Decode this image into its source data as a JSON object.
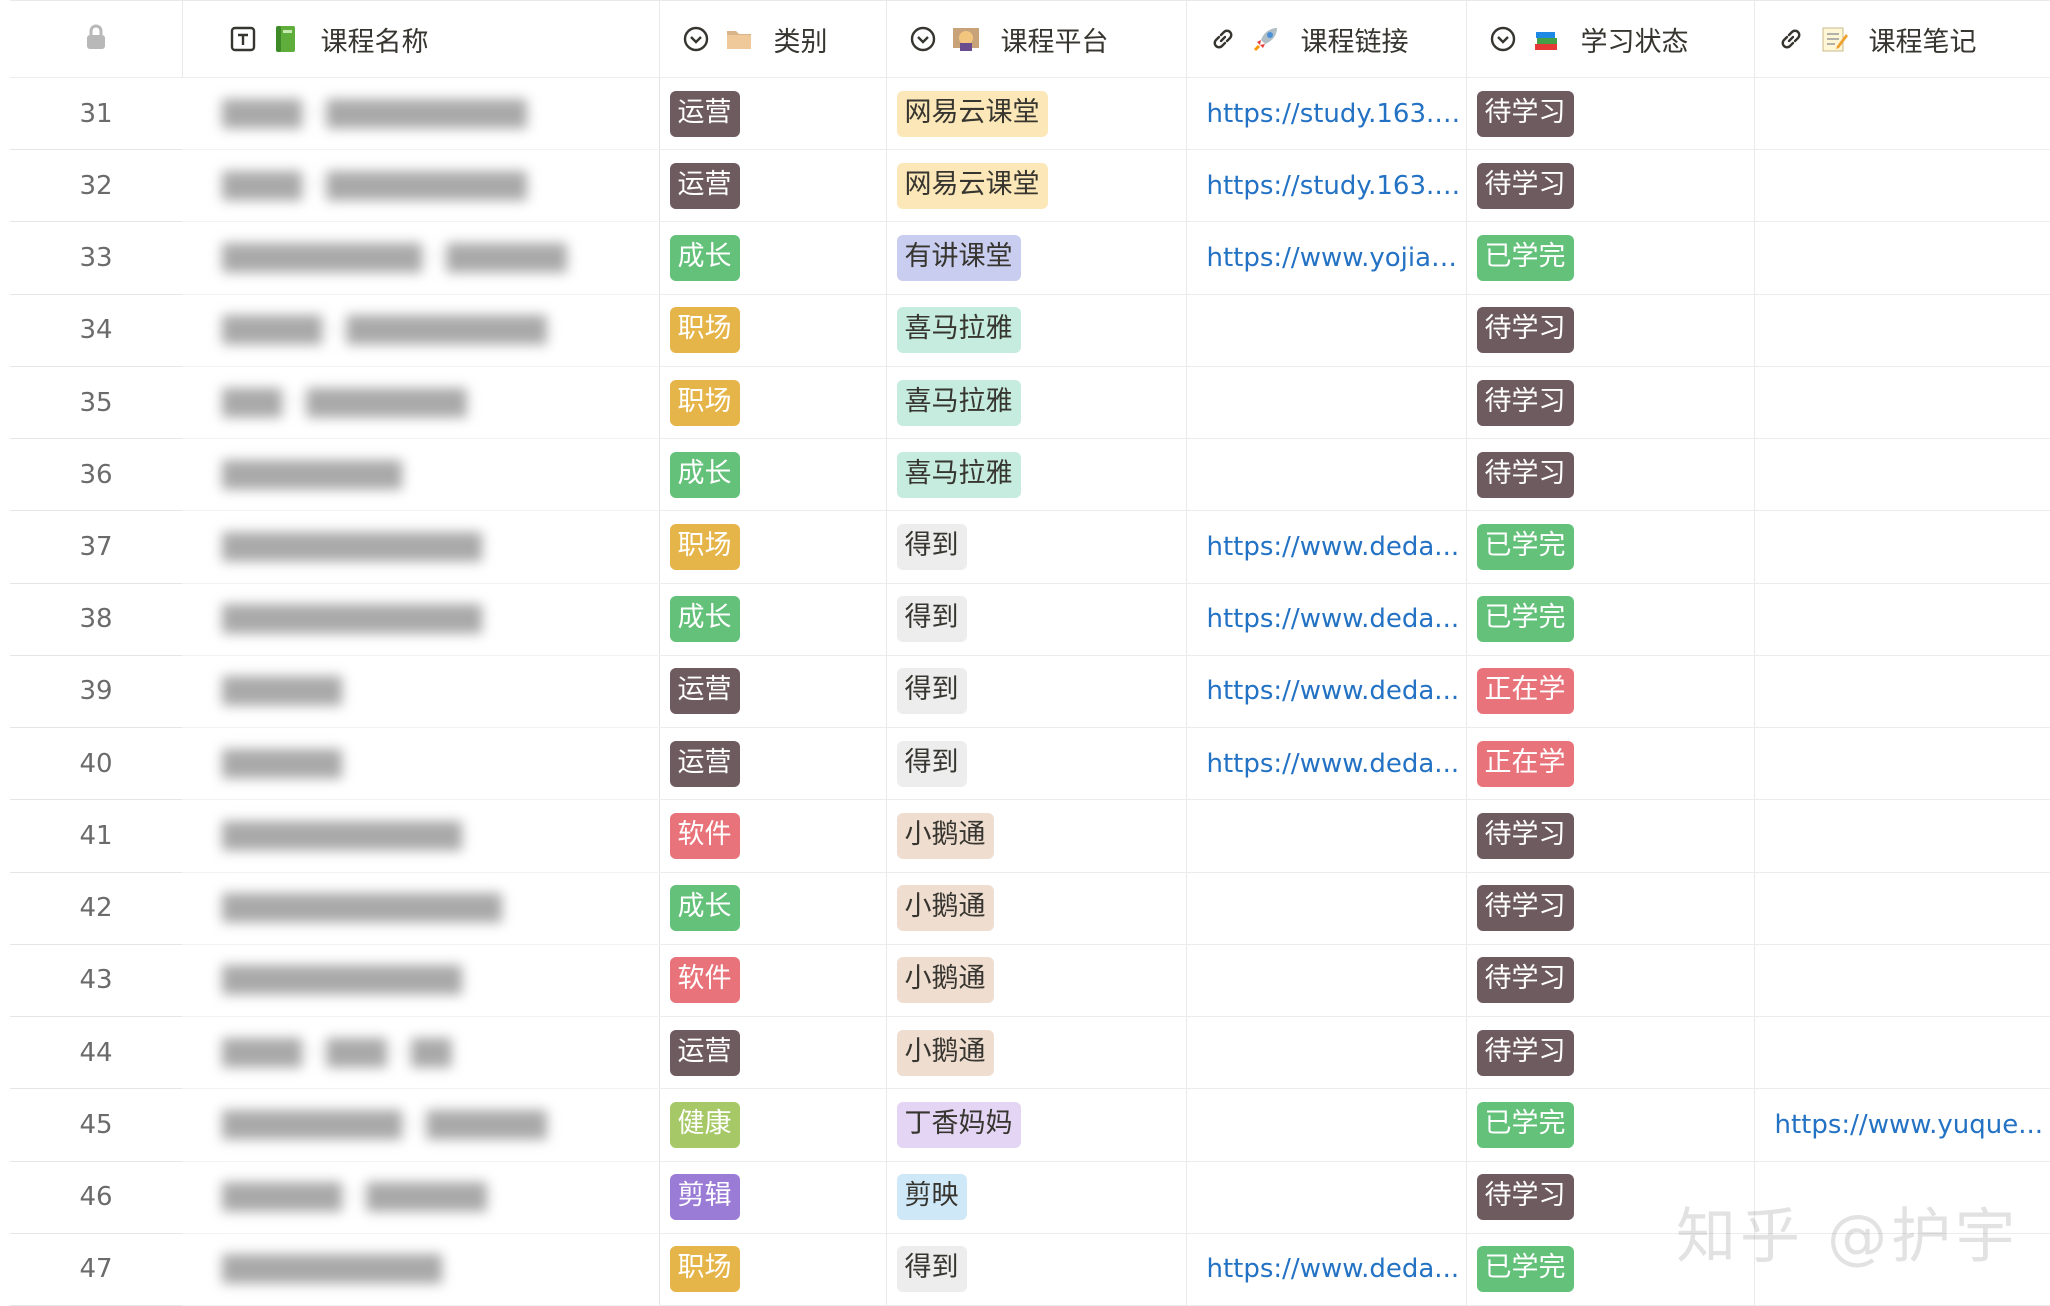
{
  "header": {
    "columns": [
      {
        "name": "col-lock",
        "type": "lock"
      },
      {
        "name": "col-course-name",
        "label": "课程名称",
        "field_type_icon": "text-type-icon",
        "emoji_icon": "green-book-icon"
      },
      {
        "name": "col-category",
        "label": "类别",
        "field_type_icon": "select-type-icon",
        "emoji_icon": "folder-icon"
      },
      {
        "name": "col-platform",
        "label": "课程平台",
        "field_type_icon": "select-type-icon",
        "emoji_icon": "teacher-icon"
      },
      {
        "name": "col-link",
        "label": "课程链接",
        "field_type_icon": "link-type-icon",
        "emoji_icon": "rocket-icon"
      },
      {
        "name": "col-status",
        "label": "学习状态",
        "field_type_icon": "select-type-icon",
        "emoji_icon": "books-icon"
      },
      {
        "name": "col-notes",
        "label": "课程笔记",
        "field_type_icon": "link-type-icon",
        "emoji_icon": "memo-icon"
      }
    ]
  },
  "tag_colors": {
    "运营": {
      "bg": "#6e5b60",
      "fg": "#ffffff"
    },
    "成长": {
      "bg": "#63c17a",
      "fg": "#ffffff"
    },
    "职场": {
      "bg": "#e6b54a",
      "fg": "#ffffff"
    },
    "软件": {
      "bg": "#e8737a",
      "fg": "#ffffff"
    },
    "健康": {
      "bg": "#a7c867",
      "fg": "#ffffff"
    },
    "剪辑": {
      "bg": "#9a7bd6",
      "fg": "#ffffff"
    },
    "网易云课堂": {
      "bg": "#fbe7b8",
      "fg": "#37352f"
    },
    "有讲课堂": {
      "bg": "#c9cdef",
      "fg": "#37352f"
    },
    "喜马拉雅": {
      "bg": "#c5ecdf",
      "fg": "#37352f"
    },
    "得到": {
      "bg": "#ededed",
      "fg": "#37352f"
    },
    "小鹅通": {
      "bg": "#efddd0",
      "fg": "#37352f"
    },
    "丁香妈妈": {
      "bg": "#e3d5f3",
      "fg": "#37352f"
    },
    "剪映": {
      "bg": "#cfe8f7",
      "fg": "#37352f"
    },
    "待学习": {
      "bg": "#6e5b60",
      "fg": "#ffffff"
    },
    "已学完": {
      "bg": "#63c17a",
      "fg": "#ffffff"
    },
    "正在学": {
      "bg": "#e8737a",
      "fg": "#ffffff"
    }
  },
  "rows": [
    {
      "num": "31",
      "name": "████ · ██████████",
      "category": "运营",
      "platform": "网易云课堂",
      "link": "https://study.163.c...",
      "status": "待学习",
      "notes": ""
    },
    {
      "num": "32",
      "name": "████ · ██████████",
      "category": "运营",
      "platform": "网易云课堂",
      "link": "https://study.163.c...",
      "status": "待学习",
      "notes": ""
    },
    {
      "num": "33",
      "name": "██████████ · ██████",
      "category": "成长",
      "platform": "有讲课堂",
      "link": "https://www.yojian...",
      "status": "已学完",
      "notes": ""
    },
    {
      "num": "34",
      "name": "█████ · ██████████",
      "category": "职场",
      "platform": "喜马拉雅",
      "link": "",
      "status": "待学习",
      "notes": ""
    },
    {
      "num": "35",
      "name": "███ · ████████",
      "category": "职场",
      "platform": "喜马拉雅",
      "link": "",
      "status": "待学习",
      "notes": ""
    },
    {
      "num": "36",
      "name": "█████████",
      "category": "成长",
      "platform": "喜马拉雅",
      "link": "",
      "status": "待学习",
      "notes": ""
    },
    {
      "num": "37",
      "name": "█████████████",
      "category": "职场",
      "platform": "得到",
      "link": "https://www.deda...",
      "status": "已学完",
      "notes": ""
    },
    {
      "num": "38",
      "name": "█████████████",
      "category": "成长",
      "platform": "得到",
      "link": "https://www.deda...",
      "status": "已学完",
      "notes": ""
    },
    {
      "num": "39",
      "name": "██████",
      "category": "运营",
      "platform": "得到",
      "link": "https://www.deda...",
      "status": "正在学",
      "notes": ""
    },
    {
      "num": "40",
      "name": "██████",
      "category": "运营",
      "platform": "得到",
      "link": "https://www.deda...",
      "status": "正在学",
      "notes": ""
    },
    {
      "num": "41",
      "name": "████████████",
      "category": "软件",
      "platform": "小鹅通",
      "link": "",
      "status": "待学习",
      "notes": ""
    },
    {
      "num": "42",
      "name": "██████████████",
      "category": "成长",
      "platform": "小鹅通",
      "link": "",
      "status": "待学习",
      "notes": ""
    },
    {
      "num": "43",
      "name": "████████████",
      "category": "软件",
      "platform": "小鹅通",
      "link": "",
      "status": "待学习",
      "notes": ""
    },
    {
      "num": "44",
      "name": "████ · ███ · ██",
      "category": "运营",
      "platform": "小鹅通",
      "link": "",
      "status": "待学习",
      "notes": ""
    },
    {
      "num": "45",
      "name": "█████████ · ██████",
      "category": "健康",
      "platform": "丁香妈妈",
      "link": "",
      "status": "已学完",
      "notes": "https://www.yuque..."
    },
    {
      "num": "46",
      "name": "██████ · ██████",
      "category": "剪辑",
      "platform": "剪映",
      "link": "",
      "status": "待学习",
      "notes": ""
    },
    {
      "num": "47",
      "name": "███████████",
      "category": "职场",
      "platform": "得到",
      "link": "https://www.deda...",
      "status": "已学完",
      "notes": ""
    }
  ],
  "watermark": "知乎 @护宇"
}
